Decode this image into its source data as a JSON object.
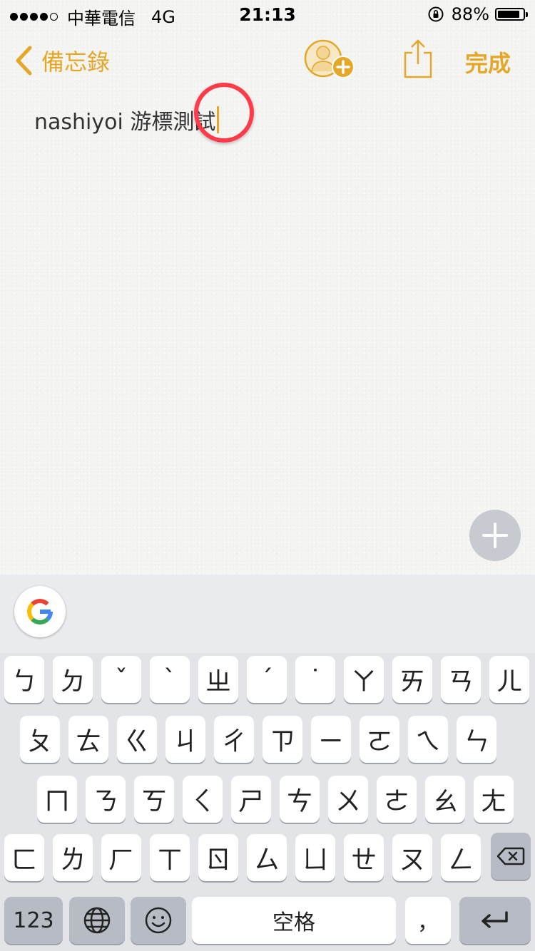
{
  "status_bar": {
    "carrier": "中華電信",
    "network": "4G",
    "time": "21:13",
    "battery_percent": "88%",
    "battery_level": 0.88
  },
  "nav": {
    "back_label": "備忘錄",
    "done_label": "完成"
  },
  "note": {
    "text": "nashiyoi 游標測試"
  },
  "keyboard": {
    "row1": [
      "ㄅ",
      "ㄉ",
      "ˇ",
      "ˋ",
      "ㄓ",
      "ˊ",
      "˙",
      "ㄚ",
      "ㄞ",
      "ㄢ",
      "ㄦ"
    ],
    "row2": [
      "ㄆ",
      "ㄊ",
      "ㄍ",
      "ㄐ",
      "ㄔ",
      "ㄗ",
      "ㄧ",
      "ㄛ",
      "ㄟ",
      "ㄣ"
    ],
    "row3": [
      "ㄇ",
      "ㄋ",
      "ㄎ",
      "ㄑ",
      "ㄕ",
      "ㄘ",
      "ㄨ",
      "ㄜ",
      "ㄠ",
      "ㄤ"
    ],
    "row4": [
      "ㄈ",
      "ㄌ",
      "ㄏ",
      "ㄒ",
      "ㄖ",
      "ㄙ",
      "ㄩ",
      "ㄝ",
      "ㄡ",
      "ㄥ"
    ],
    "numbers_label": "123",
    "space_label": "空格",
    "comma_label": "，"
  },
  "colors": {
    "accent": "#e4a728",
    "highlight": "#ff3b4a"
  }
}
